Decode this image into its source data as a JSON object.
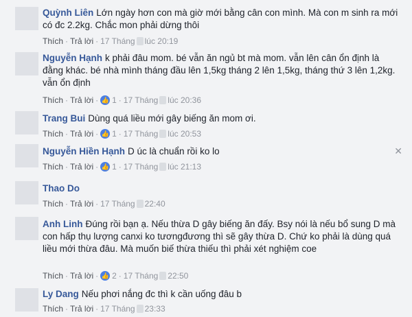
{
  "comments": [
    {
      "author": "Quỳnh Liên",
      "text": "Lớn ngày hơn con mà giờ mới bằng cân con mình. Mà con m sinh ra mới có đc 2.2kg. Chắc mon phải dừng thôi",
      "like_label": "Thích",
      "reply_label": "Trả lời",
      "date": "17 Tháng",
      "time": "lúc 20:19",
      "reactions": ""
    },
    {
      "author": "Nguyễn Hạnh",
      "text": "k phải đâu mom. bé vẫn ăn ngủ bt mà mom. vẫn lên cân ổn định là đằng khác. bé nhà mình tháng đầu lên 1,5kg tháng 2 lên 1,5kg, tháng thứ 3 lên 1,2kg. vẫn ổn định",
      "like_label": "Thích",
      "reply_label": "Trả lời",
      "date": "17 Tháng",
      "time": "lúc 20:36",
      "reactions": "1"
    },
    {
      "author": "Trang Bui",
      "text": "Dùng quá liều mới gây biếng ăn mom ơi.",
      "like_label": "Thích",
      "reply_label": "Trả lời",
      "date": "17 Tháng",
      "time": "lúc 20:53",
      "reactions": "1"
    },
    {
      "author": "Nguyễn Hiền Hạnh",
      "text": "D úc là chuẩn rồi ko lo",
      "like_label": "Thích",
      "reply_label": "Trả lời",
      "date": "17 Tháng",
      "time": "lúc 21:13",
      "reactions": "1"
    },
    {
      "author": "Thao Do",
      "text": "",
      "like_label": "Thích",
      "reply_label": "Trả lời",
      "date": "17 Tháng",
      "time": "22:40",
      "reactions": ""
    },
    {
      "author": "Anh Linh",
      "text": "Đúng rồi bạn ạ. Nếu thừa D gây biếng ăn đấy. Bsy nói là nếu bổ sung D mà con hấp thụ lượng canxi ko tươngđương thì sẽ gây thừa D. Chứ ko phải là dùng quá liều mới thừa đâu. Mà muốn biế thừa thiếu thì phải xét nghiệm coe",
      "like_label": "Thích",
      "reply_label": "Trả lời",
      "date": "17 Tháng",
      "time": "22:50",
      "reactions": "2"
    },
    {
      "author": "Ly Dang",
      "text": "Nếu phơi nắng đc thì k cần uống đâu b",
      "like_label": "Thích",
      "reply_label": "Trả lời",
      "date": "17 Tháng",
      "time": "23:33",
      "reactions": ""
    }
  ],
  "close_glyph": "✕",
  "colors": {
    "author": "#365899",
    "like_badge": "#4b7fe3",
    "background": "#f2f3f5"
  }
}
